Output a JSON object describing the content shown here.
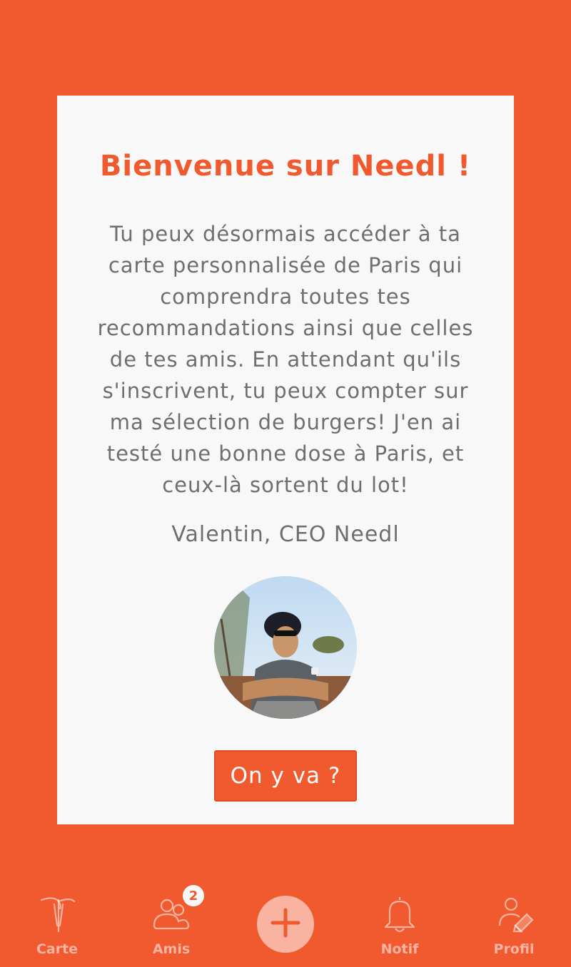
{
  "welcome": {
    "title": "Bienvenue sur Needl !",
    "body_lines": [
      "Tu peux désormais accéder à ta",
      "carte personnalisée de Paris qui",
      "comprendra toutes tes",
      "recommandations ainsi que celles",
      "de tes amis. En attendant qu'ils",
      "s'inscrivent, tu peux compter sur",
      "ma sélection de burgers! J'en ai",
      "testé une bonne dose à Paris, et",
      "ceux-là sortent du lot!"
    ],
    "signature": "Valentin, CEO Needl",
    "cta_label": "On y va ?"
  },
  "tabbar": {
    "carte": {
      "label": "Carte",
      "icon": "needle-icon"
    },
    "amis": {
      "label": "Amis",
      "icon": "friends-icon",
      "badge": "2"
    },
    "add": {
      "icon": "plus-icon"
    },
    "notif": {
      "label": "Notif",
      "icon": "bell-icon"
    },
    "profil": {
      "label": "Profil",
      "icon": "profile-edit-icon"
    }
  },
  "colors": {
    "accent": "#F05A2E",
    "card_bg": "#F8F8F8",
    "text": "#6E6E6E"
  }
}
